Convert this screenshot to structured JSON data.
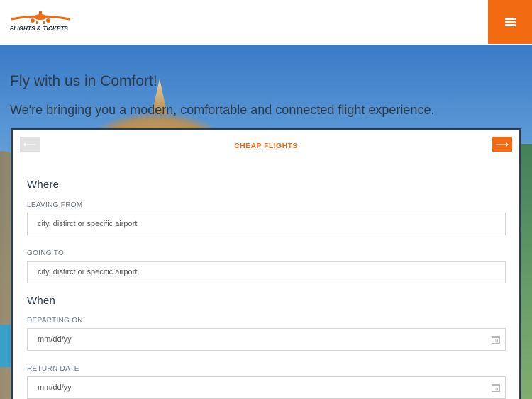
{
  "brand": {
    "logo_text": "FLIGHTS & TICKETS",
    "accent_color": "#f26b10",
    "dark_color": "#2c3e50"
  },
  "header": {
    "menu_icon": "hamburger-menu-icon"
  },
  "hero": {
    "headline": "Fly with us in Comfort!",
    "subline": "We're bringing you a modern, comfortable and connected flight experience."
  },
  "search": {
    "title": "CHEAP FLIGHTS",
    "prev_icon": "arrow-left-icon",
    "next_icon": "arrow-right-icon",
    "where": {
      "heading": "Where",
      "leaving_label": "LEAVING FROM",
      "leaving_placeholder": "city, distirct or specific airport",
      "going_label": "GOING TO",
      "going_placeholder": "city, distirct or specific airport"
    },
    "when": {
      "heading": "When",
      "departing_label": "DEPARTING ON",
      "departing_placeholder": "mm/dd/yy",
      "return_label": "RETURN DATE",
      "return_placeholder": "mm/dd/yy",
      "calendar_icon": "calendar-icon"
    }
  }
}
